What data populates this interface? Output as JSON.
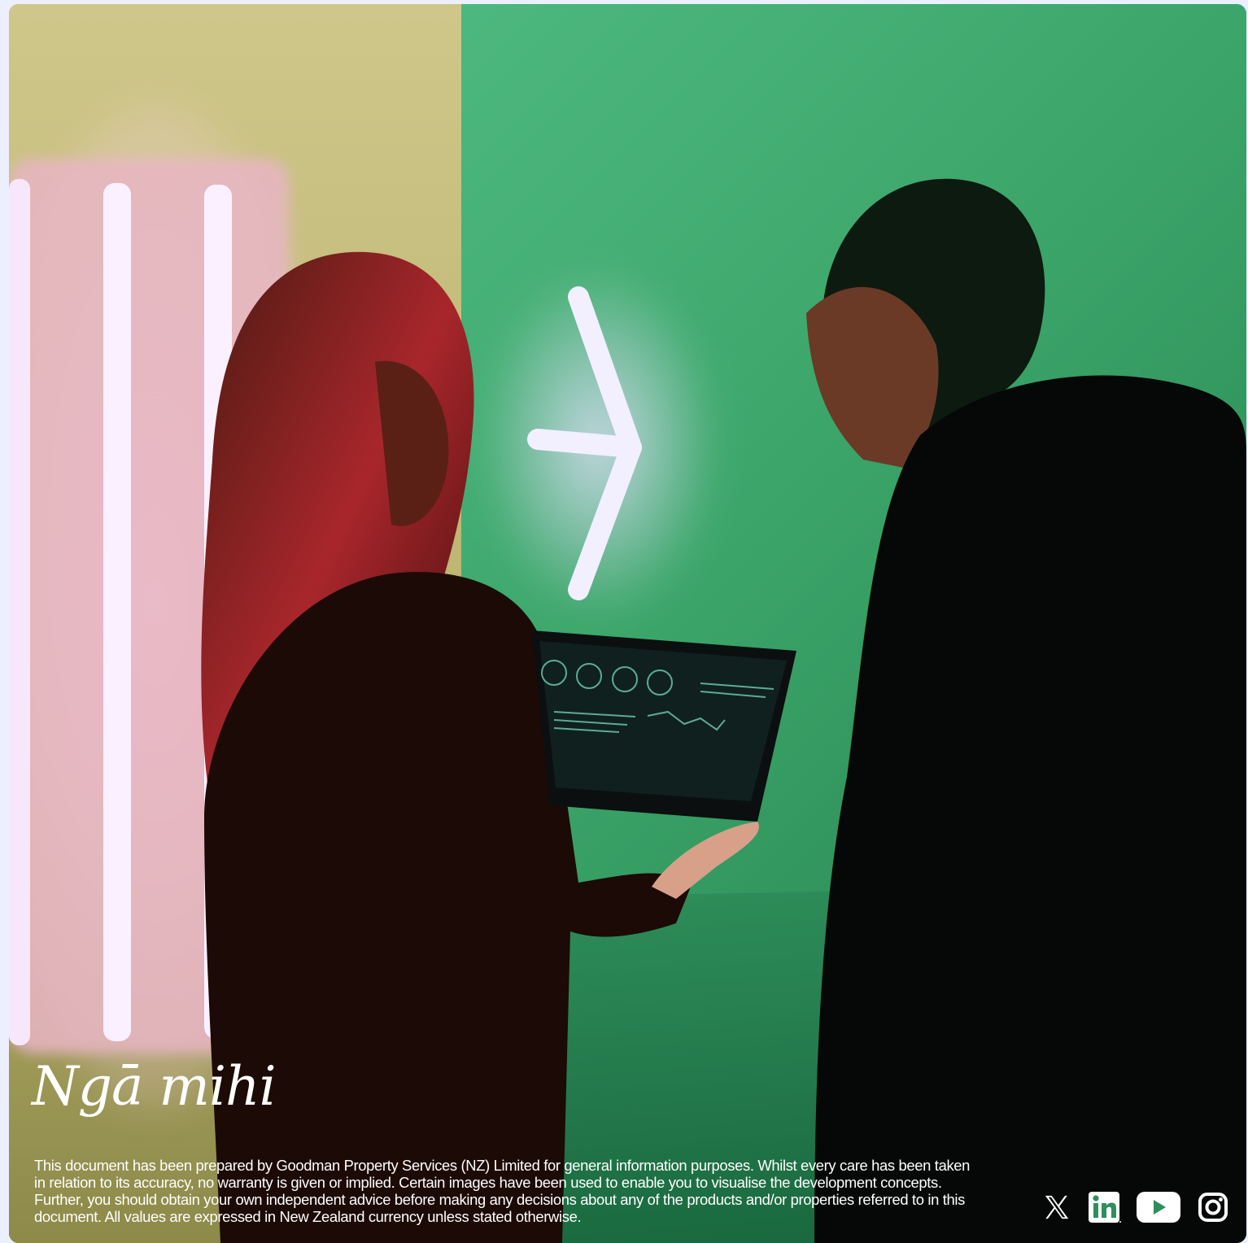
{
  "closing": {
    "signature": "Ngā mihi",
    "disclaimer": "This document has been prepared by Goodman Property Services (NZ) Limited for general information purposes. Whilst every care has been taken in relation to its accuracy, no warranty is given or implied. Certain images have been used to enable you to visualise the development concepts. Further, you should obtain your own independent advice before making any decisions about any of the products and/or properties referred to in this document. All values are expressed in New Zealand currency unless stated otherwise."
  },
  "social_links": [
    {
      "name": "x-icon"
    },
    {
      "name": "linkedin-icon"
    },
    {
      "name": "youtube-icon"
    },
    {
      "name": "instagram-icon"
    }
  ],
  "colors": {
    "page_background": "#eceffe",
    "wall_green": "#3aa36a",
    "wall_yellow": "#c9c77a",
    "neon_pink": "#f4c9e0",
    "text": "#ffffff"
  }
}
